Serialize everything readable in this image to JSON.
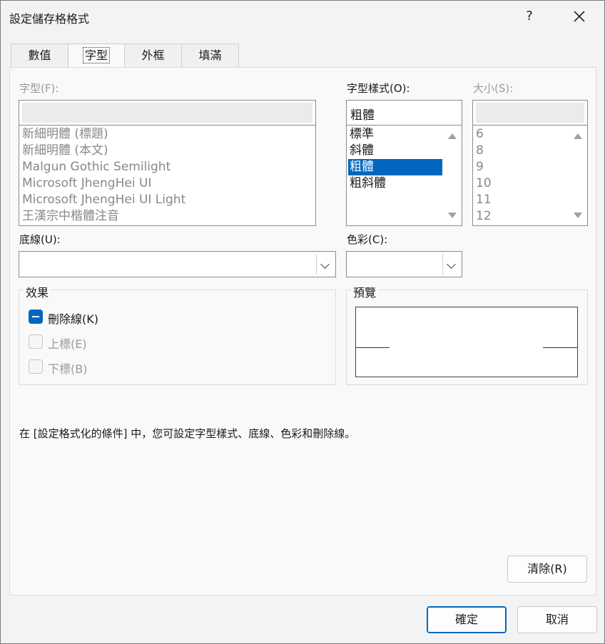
{
  "window": {
    "title": "設定儲存格格式",
    "help_label": "?"
  },
  "tabs": [
    {
      "label": "數值"
    },
    {
      "label": "字型",
      "active": true
    },
    {
      "label": "外框"
    },
    {
      "label": "填滿"
    }
  ],
  "font": {
    "label": "字型(F):",
    "value": "",
    "items": [
      "新細明體 (標題)",
      "新細明體 (本文)",
      "Malgun Gothic Semilight",
      "Microsoft JhengHei UI",
      "Microsoft JhengHei UI Light",
      "王漢宗中楷體注音"
    ]
  },
  "style": {
    "label": "字型樣式(O):",
    "value": "粗體",
    "items": [
      "標準",
      "斜體",
      "粗體",
      "粗斜體"
    ],
    "selected_index": 2
  },
  "size": {
    "label": "大小(S):",
    "value": "",
    "items": [
      "6",
      "8",
      "9",
      "10",
      "11",
      "12"
    ]
  },
  "underline": {
    "label": "底線(U):",
    "value": ""
  },
  "color": {
    "label": "色彩(C):",
    "value": ""
  },
  "effects": {
    "title": "效果",
    "strikethrough": {
      "label": "刪除線(K)",
      "state": "indeterminate"
    },
    "superscript": {
      "label": "上標(E)",
      "state": "unchecked",
      "disabled": true
    },
    "subscript": {
      "label": "下標(B)",
      "state": "unchecked",
      "disabled": true
    }
  },
  "preview": {
    "title": "預覽"
  },
  "info_text": "在 [設定格式化的條件] 中，您可設定字型樣式、底線、色彩和刪除線。",
  "buttons": {
    "clear": "清除(R)",
    "ok": "確定",
    "cancel": "取消"
  },
  "colors": {
    "accent": "#0067c0",
    "selection_text": "#ffffff"
  }
}
